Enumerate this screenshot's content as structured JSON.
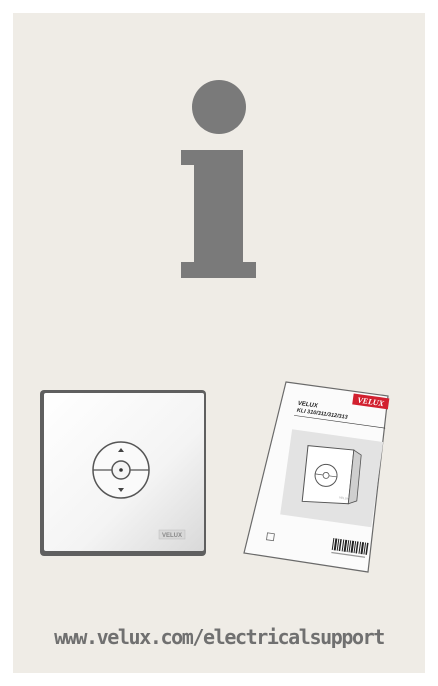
{
  "page": {
    "background_color": "#efece6",
    "icon_color": "#7a7a7a",
    "info_icon": "information-i-icon",
    "url_text": "www.velux.com/electricalsupport"
  },
  "switch": {
    "brand_label": "VELUX",
    "up_icon": "triangle-up-icon",
    "down_icon": "triangle-down-icon",
    "center_icon": "dot-icon"
  },
  "manual": {
    "brand_logo": "VELUX",
    "title": "VELUX",
    "model": "KLI 310/311/312/313",
    "image_brand_label": "VELUX"
  },
  "colors": {
    "velux_red": "#d2202f",
    "text_gray": "#707070"
  }
}
